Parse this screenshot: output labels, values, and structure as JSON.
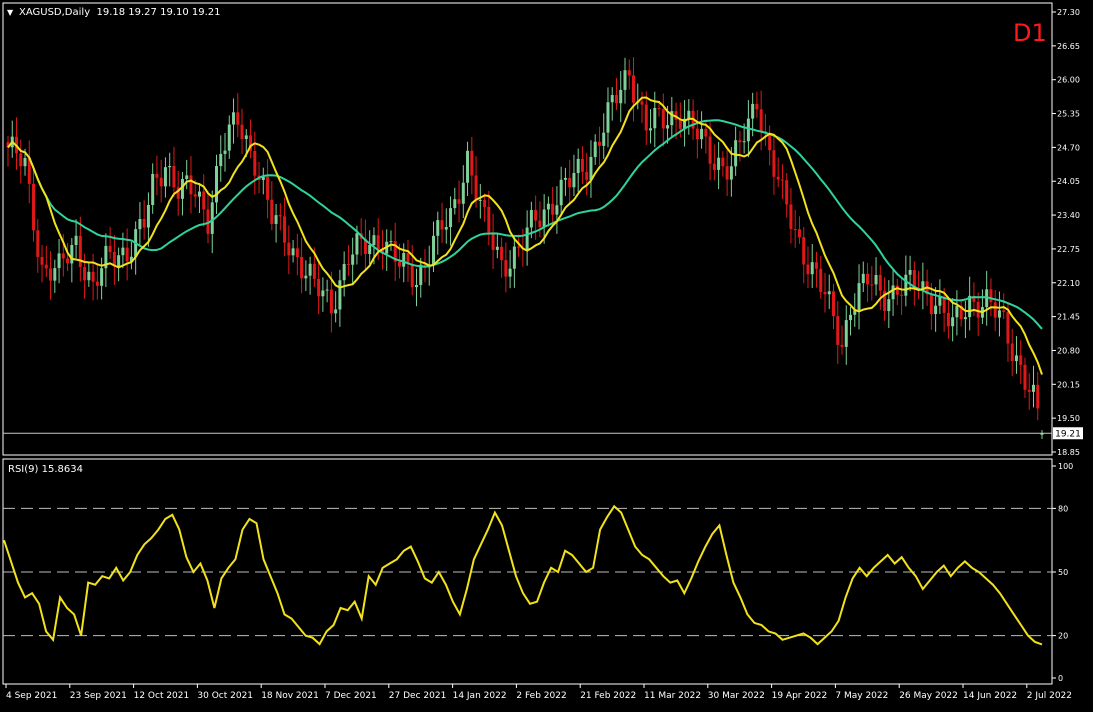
{
  "header": {
    "symbol_line": "XAGUSD,Daily  19.18 19.27 19.10 19.21",
    "timeframe_badge": "D1"
  },
  "rsi_header": "RSI(9) 15.8634",
  "current_price_label": "19.21",
  "colors": {
    "background": "#000000",
    "bull_candle": "#7fd19a",
    "bear_candle": "#e01818",
    "ma_fast": "#f2e21b",
    "ma_slow": "#2fd39c",
    "rsi_line": "#f2e21b",
    "badge": "#ff1a1a",
    "axis_text": "#ffffff"
  },
  "chart_data": [
    {
      "type": "candlestick",
      "title": "XAGUSD,Daily",
      "ohlc_last": {
        "open": 19.18,
        "high": 19.27,
        "low": 19.1,
        "close": 19.21
      },
      "ylim": [
        18.85,
        27.3
      ],
      "y_ticks": [
        "27.30",
        "26.65",
        "26.00",
        "25.35",
        "24.70",
        "24.05",
        "23.40",
        "22.75",
        "22.10",
        "21.45",
        "20.80",
        "20.15",
        "19.50",
        "18.85"
      ],
      "x_tick_labels": [
        "4 Sep 2021",
        "23 Sep 2021",
        "12 Oct 2021",
        "30 Oct 2021",
        "18 Nov 2021",
        "7 Dec 2021",
        "27 Dec 2021",
        "14 Jan 2022",
        "2 Feb 2022",
        "21 Feb 2022",
        "11 Mar 2022",
        "30 Mar 2022",
        "19 Apr 2022",
        "7 May 2022",
        "26 May 2022",
        "14 Jun 2022",
        "2 Jul 2022"
      ],
      "close_keypoints": [
        [
          0,
          24.7
        ],
        [
          4,
          24.3
        ],
        [
          8,
          22.4
        ],
        [
          12,
          22.3
        ],
        [
          16,
          22.9
        ],
        [
          20,
          22.0
        ],
        [
          24,
          22.6
        ],
        [
          28,
          22.75
        ],
        [
          32,
          23.2
        ],
        [
          34,
          23.9
        ],
        [
          37,
          24.45
        ],
        [
          40,
          23.9
        ],
        [
          44,
          23.8
        ],
        [
          47,
          23.4
        ],
        [
          50,
          24.6
        ],
        [
          54,
          25.2
        ],
        [
          58,
          24.5
        ],
        [
          62,
          23.3
        ],
        [
          66,
          22.9
        ],
        [
          72,
          22.0
        ],
        [
          76,
          21.7
        ],
        [
          80,
          22.6
        ],
        [
          84,
          22.8
        ],
        [
          88,
          23.0
        ],
        [
          92,
          22.4
        ],
        [
          96,
          22.2
        ],
        [
          100,
          22.9
        ],
        [
          104,
          23.3
        ],
        [
          108,
          24.55
        ],
        [
          112,
          23.2
        ],
        [
          116,
          22.5
        ],
        [
          120,
          22.7
        ],
        [
          124,
          23.3
        ],
        [
          128,
          23.7
        ],
        [
          132,
          24.0
        ],
        [
          136,
          24.4
        ],
        [
          140,
          25.1
        ],
        [
          144,
          25.8
        ],
        [
          146,
          26.2
        ],
        [
          150,
          25.1
        ],
        [
          154,
          25.2
        ],
        [
          158,
          25.4
        ],
        [
          162,
          24.9
        ],
        [
          166,
          24.5
        ],
        [
          170,
          24.3
        ],
        [
          174,
          25.1
        ],
        [
          176,
          25.7
        ],
        [
          178,
          24.9
        ],
        [
          182,
          23.7
        ],
        [
          186,
          22.9
        ],
        [
          190,
          22.2
        ],
        [
          194,
          21.4
        ],
        [
          196,
          20.95
        ],
        [
          198,
          21.7
        ],
        [
          202,
          22.1
        ],
        [
          206,
          21.9
        ],
        [
          210,
          22.0
        ],
        [
          214,
          22.05
        ],
        [
          218,
          21.8
        ],
        [
          222,
          21.2
        ],
        [
          226,
          21.8
        ],
        [
          230,
          21.7
        ],
        [
          234,
          21.3
        ],
        [
          238,
          20.5
        ],
        [
          241,
          19.8
        ],
        [
          243,
          19.21
        ]
      ],
      "series": [
        {
          "name": "",
          "type": "moving-average",
          "color": "#f2e21b"
        },
        {
          "name": "",
          "type": "moving-average",
          "color": "#2fd39c"
        }
      ]
    },
    {
      "type": "line",
      "title": "RSI(9) 15.8634",
      "ylim": [
        0,
        100
      ],
      "y_ticks": [
        100,
        80,
        50,
        20,
        0
      ],
      "levels": [
        80,
        50,
        20
      ],
      "series": [
        {
          "name": "RSI(9)",
          "color": "#f2e21b",
          "values": [
            65,
            55,
            45,
            38,
            40,
            35,
            22,
            18,
            38,
            33,
            30,
            20,
            45,
            44,
            48,
            47,
            52,
            46,
            50,
            58,
            63,
            66,
            70,
            75,
            77,
            70,
            57,
            50,
            54,
            46,
            33,
            47,
            52,
            56,
            70,
            75,
            73,
            56,
            48,
            40,
            30,
            28,
            24,
            20,
            19,
            16,
            22,
            25,
            33,
            32,
            36,
            28,
            48,
            44,
            52,
            54,
            56,
            60,
            62,
            55,
            47,
            45,
            50,
            44,
            36,
            30,
            42,
            56,
            63,
            70,
            78,
            72,
            60,
            48,
            40,
            35,
            36,
            45,
            52,
            50,
            60,
            58,
            54,
            50,
            52,
            70,
            76,
            81,
            78,
            70,
            62,
            58,
            56,
            52,
            48,
            45,
            46,
            40,
            47,
            55,
            62,
            68,
            72,
            58,
            45,
            38,
            30,
            26,
            25,
            22,
            21,
            18,
            19,
            20,
            21,
            19,
            16,
            19,
            22,
            27,
            38,
            47,
            52,
            48,
            52,
            55,
            58,
            54,
            57,
            52,
            48,
            42,
            46,
            50,
            53,
            48,
            52,
            55,
            52,
            50,
            47,
            44,
            40,
            35,
            30,
            25,
            20,
            17,
            15.86
          ]
        }
      ]
    }
  ]
}
